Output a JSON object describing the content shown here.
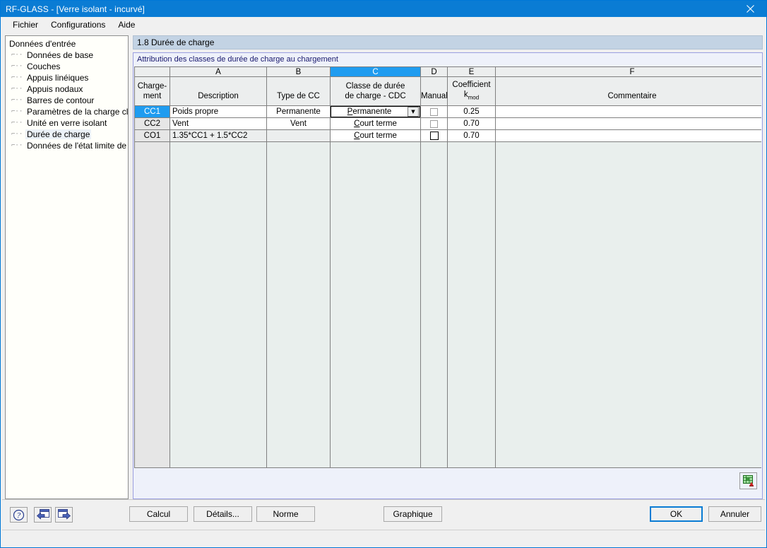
{
  "window": {
    "title": "RF-GLASS - [Verre isolant - incurvé]",
    "close_icon": "close-icon",
    "titlebar_color": "#0a7cd4"
  },
  "menu": {
    "items": [
      {
        "label": "Fichier"
      },
      {
        "label": "Configurations"
      },
      {
        "label": "Aide"
      }
    ]
  },
  "sidebar": {
    "root": "Données d'entrée",
    "items": [
      {
        "label": "Données de base",
        "selected": false
      },
      {
        "label": "Couches",
        "selected": false
      },
      {
        "label": "Appuis linéiques",
        "selected": false
      },
      {
        "label": "Appuis nodaux",
        "selected": false
      },
      {
        "label": "Barres de contour",
        "selected": false
      },
      {
        "label": "Paramètres de la charge climati",
        "selected": false
      },
      {
        "label": "Unité en verre isolant",
        "selected": false
      },
      {
        "label": "Durée de charge",
        "selected": true
      },
      {
        "label": "Données de l'état limite de serv",
        "selected": false
      }
    ],
    "scroll_left_icon": "chevron-left-icon",
    "scroll_right_icon": "chevron-right-icon"
  },
  "content": {
    "section_title": "1.8 Durée de charge",
    "panel_title": "Attribution des classes de durée de charge au chargement",
    "grid_icon": "table-export-icon"
  },
  "table": {
    "column_letters": [
      "",
      "A",
      "B",
      "C",
      "D",
      "E",
      "F"
    ],
    "active_column": "C",
    "headers": {
      "row_key": [
        "Charge-",
        "ment"
      ],
      "a": "Description",
      "b": "Type de CC",
      "c_line1": "Classe de durée",
      "c_line2": "de charge - CDC",
      "d": "Manual",
      "e_line1": "Coefficient",
      "e_line2": "k",
      "e_sub": "mod",
      "f": "Commentaire"
    },
    "rows": [
      {
        "key": "CC1",
        "selected": true,
        "description": "Poids propre",
        "type_cc": "Permanente",
        "cdc_mnemonic": "P",
        "cdc_rest": "ermanente",
        "is_combo": true,
        "manual": false,
        "manual_strong": false,
        "kmod": "0.25",
        "comment": ""
      },
      {
        "key": "CC2",
        "selected": false,
        "description": "Vent",
        "type_cc": "Vent",
        "cdc_mnemonic": "C",
        "cdc_rest": "ourt terme",
        "is_combo": false,
        "manual": false,
        "manual_strong": false,
        "kmod": "0.70",
        "comment": ""
      },
      {
        "key": "CO1",
        "selected": false,
        "description": "1.35*CC1 + 1.5*CC2",
        "type_cc": "",
        "cdc_mnemonic": "C",
        "cdc_rest": "ourt terme",
        "is_combo": false,
        "manual": false,
        "manual_strong": true,
        "kmod": "0.70",
        "comment": ""
      }
    ],
    "combo_arrow_icon": "chevron-down-icon"
  },
  "toolbar": {
    "help_icon": "help-question-icon",
    "prev_icon": "previous-arrow-icon",
    "next_icon": "next-arrow-icon",
    "calcul": "Calcul",
    "details": "Détails...",
    "norme": "Norme",
    "graphique": "Graphique",
    "ok": "OK",
    "annuler": "Annuler"
  },
  "colors": {
    "accent": "#1f9cf0",
    "title": "#0a7cd4",
    "section_header": "#c3d3e4",
    "panel_bg": "#eef1fa",
    "grid_empty": "#e9efed"
  }
}
